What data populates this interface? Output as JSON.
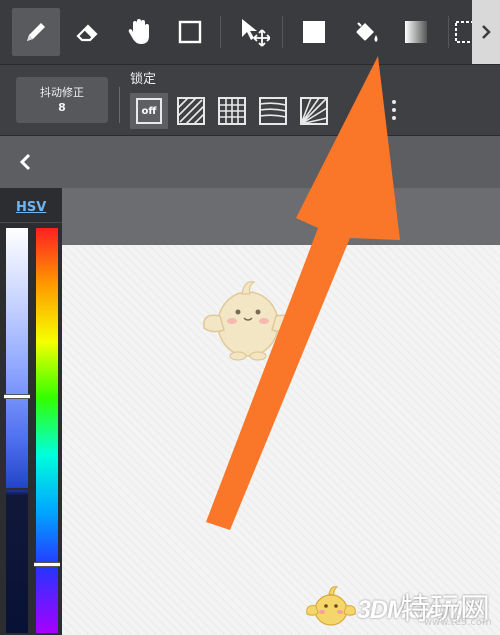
{
  "toolbar": {
    "tools": [
      "pen-tool",
      "eraser-tool",
      "hand-tool",
      "rectangle-tool",
      "move-tool",
      "fill-color-tool",
      "bucket-fill-tool",
      "gradient-tool",
      "selection-tool"
    ],
    "active_tool": "pen-tool"
  },
  "subbar": {
    "stabilizer_label": "抖动修正",
    "stabilizer_value": "8",
    "lock_label": "锁定",
    "lock_off_label": "off",
    "lock_options": [
      "off",
      "diagonal-lines",
      "grid",
      "horizontal-lines",
      "radial-lines"
    ]
  },
  "color_panel": {
    "tab_label": "HSV",
    "accent_color": "#6fb6f0",
    "hue_top_color": "#ff2020",
    "selected_blue": "#2346c8"
  },
  "overlay": {
    "arrow_color": "#fa7628"
  },
  "watermark": {
    "brand": "3DMGAME",
    "cn_text": "特玩网",
    "url": "www.te5.com"
  }
}
